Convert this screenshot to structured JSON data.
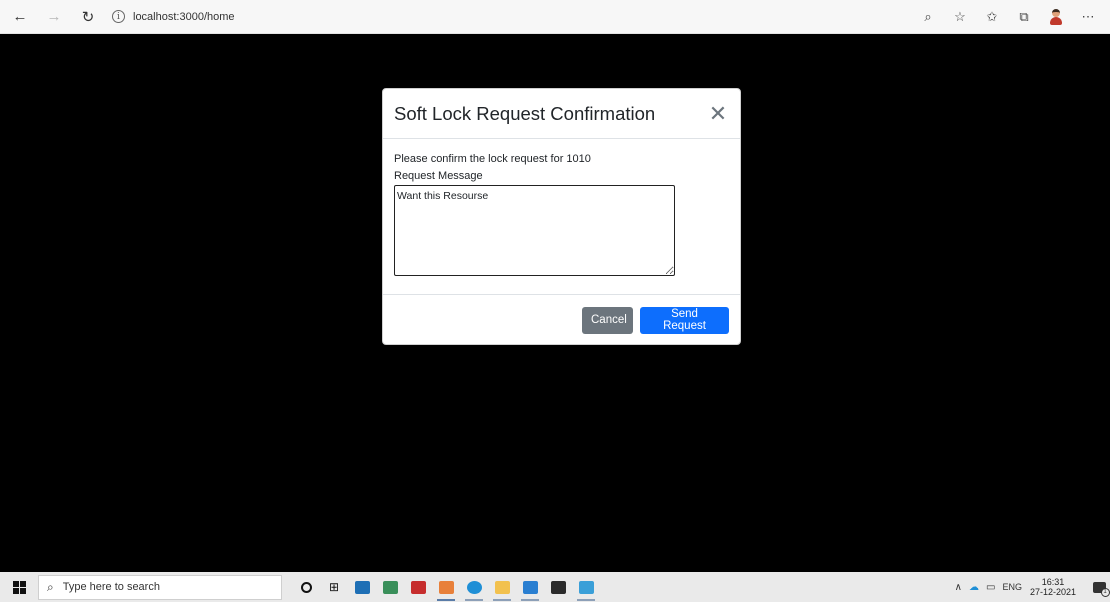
{
  "browser": {
    "url": "localhost:3000/home",
    "icons": {
      "back": "arrow-left-icon",
      "forward": "arrow-right-icon",
      "refresh": "refresh-icon",
      "info": "info-icon",
      "read_aloud": "read-aloud-icon",
      "favorite": "add-favorite-icon",
      "favorites": "favorites-icon",
      "collections": "collections-icon",
      "profile": "profile-avatar-icon",
      "more": "more-icon"
    }
  },
  "modal": {
    "title": "Soft Lock Request Confirmation",
    "confirm_text": "Please confirm the lock request for 1010",
    "message_label": "Request Message",
    "message_value": "Want this Resourse",
    "cancel_label": "Cancel",
    "send_label": "Send Request"
  },
  "taskbar": {
    "search_placeholder": "Type here to search",
    "language": "ENG",
    "time": "16:31",
    "date": "27-12-2021",
    "notification_count": "1",
    "apps": [
      {
        "name": "cortana",
        "color": "#111111"
      },
      {
        "name": "task-view",
        "color": "#111111"
      },
      {
        "name": "mail",
        "color": "#1e6fb5"
      },
      {
        "name": "photos-people",
        "color": "#3a8f5a"
      },
      {
        "name": "vscode-like-app",
        "color": "#c62d2d"
      },
      {
        "name": "teams",
        "color": "#e8803a"
      },
      {
        "name": "edge",
        "color": "#1f8fd6"
      },
      {
        "name": "file-explorer",
        "color": "#f2c14e"
      },
      {
        "name": "visual-studio-code",
        "color": "#2a7fd1"
      },
      {
        "name": "terminal",
        "color": "#2b2b2b"
      },
      {
        "name": "image-viewer",
        "color": "#3a9fd8"
      }
    ]
  }
}
